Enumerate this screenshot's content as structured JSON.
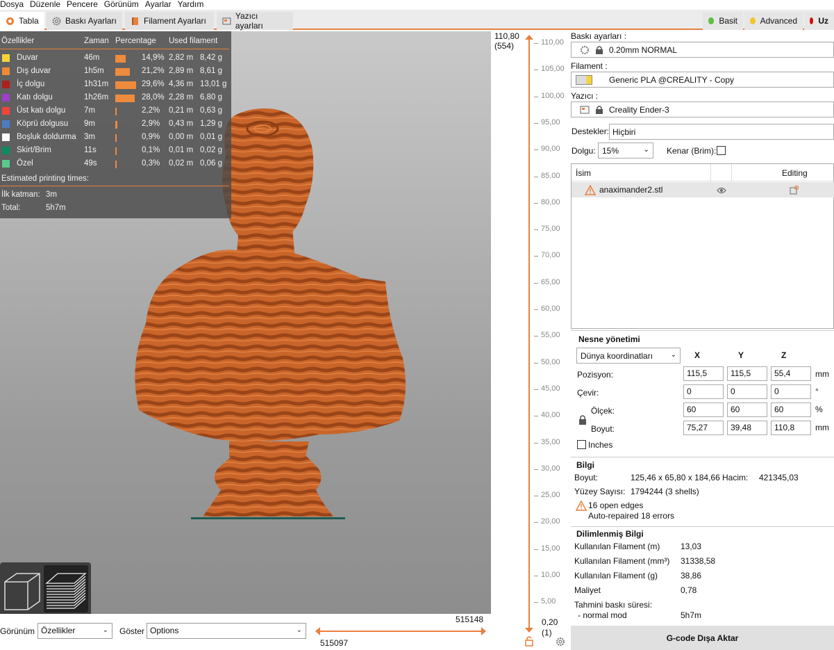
{
  "menu": [
    "Dosya",
    "Düzenle",
    "Pencere",
    "Görünüm",
    "Ayarlar",
    "Yardım"
  ],
  "tabs": [
    {
      "label": "Tabla",
      "icon": "plater-icon"
    },
    {
      "label": "Baskı Ayarları",
      "icon": "gear-icon"
    },
    {
      "label": "Filament Ayarları",
      "icon": "filament-spool-icon"
    },
    {
      "label": "Yazıcı ayarları",
      "icon": "printer-icon"
    }
  ],
  "modes": [
    {
      "label": "Basit",
      "color": "#5fbf3f"
    },
    {
      "label": "Advanced",
      "color": "#f2c52d"
    },
    {
      "label": "Uz",
      "color": "#d40d0d"
    }
  ],
  "legend": {
    "headers": [
      "Özellikler",
      "Zaman",
      "Percentage",
      "Used filament"
    ],
    "rows": [
      {
        "name": "Duvar",
        "color": "#f5d43a",
        "time": "46m",
        "pct": "14,9%",
        "pct_value": 14.9,
        "length": "2,82 m",
        "weight": "8,42 g"
      },
      {
        "name": "Dış duvar",
        "color": "#f08a36",
        "time": "1h5m",
        "pct": "21,2%",
        "pct_value": 21.2,
        "length": "2,89 m",
        "weight": "8,61 g"
      },
      {
        "name": "İç dolgu",
        "color": "#b0201a",
        "time": "1h31m",
        "pct": "29,6%",
        "pct_value": 29.6,
        "length": "4,36 m",
        "weight": "13,01 g"
      },
      {
        "name": "Katı dolgu",
        "color": "#9a41c8",
        "time": "1h26m",
        "pct": "28,0%",
        "pct_value": 28.0,
        "length": "2,28 m",
        "weight": "6,80 g"
      },
      {
        "name": "Üst katı dolgu",
        "color": "#f0443d",
        "time": "7m",
        "pct": "2,2%",
        "pct_value": 2.2,
        "length": "0,21 m",
        "weight": "0,63 g"
      },
      {
        "name": "Köprü dolgusu",
        "color": "#4d7bc4",
        "time": "9m",
        "pct": "2,9%",
        "pct_value": 2.9,
        "length": "0,43 m",
        "weight": "1,29 g"
      },
      {
        "name": "Boşluk doldurma",
        "color": "#ffffff",
        "time": "3m",
        "pct": "0,9%",
        "pct_value": 0.9,
        "length": "0,00 m",
        "weight": "0,01 g"
      },
      {
        "name": "Skirt/Brim",
        "color": "#0e8a63",
        "time": "11s",
        "pct": "0,1%",
        "pct_value": 0.1,
        "length": "0,01 m",
        "weight": "0,02 g"
      },
      {
        "name": "Özel",
        "color": "#5ac98c",
        "time": "49s",
        "pct": "0,3%",
        "pct_value": 0.3,
        "length": "0,02 m",
        "weight": "0,06 g"
      }
    ],
    "estimated_label": "Estimated printing times:",
    "first_layer_label": "İlk katman:",
    "first_layer_value": "3m",
    "total_label": "Total:",
    "total_value": "5h7m"
  },
  "bottom": {
    "view_label": "Görünüm",
    "view_value": "Özellikler",
    "show_label": "Göster",
    "show_value": "Options",
    "hslider_top": "515148",
    "hslider_bottom": "515097"
  },
  "vslider": {
    "top_value": "110,80",
    "top_layer": "(554)",
    "bottom_value": "0,20",
    "bottom_layer": "(1)",
    "ticks": [
      "110,00",
      "105,00",
      "100,00",
      "95,00",
      "90,00",
      "85,00",
      "80,00",
      "75,00",
      "70,00",
      "65,00",
      "60,00",
      "55,00",
      "50,00",
      "45,00",
      "40,00",
      "35,00",
      "30,00",
      "25,00",
      "20,00",
      "15,00",
      "10,00",
      "5,00"
    ]
  },
  "right": {
    "print_settings_label": "Baskı ayarları :",
    "print_settings_value": "0.20mm NORMAL",
    "filament_label": "Filament :",
    "filament_value": "Generic PLA @CREALITY - Copy",
    "printer_label": "Yazıcı :",
    "printer_value": "Creality Ender-3",
    "supports_label": "Destekler:",
    "supports_value": "Hiçbiri",
    "infill_label": "Dolgu:",
    "infill_value": "15%",
    "brim_label": "Kenar (Brim):",
    "objects_col_name": "İsim",
    "objects_col_editing": "Editing",
    "object_name": "anaximander2.stl",
    "object_mgmt_title": "Nesne yönetimi",
    "coord_select": "Dünya koordinatları",
    "axes": [
      "X",
      "Y",
      "Z"
    ],
    "position_label": "Pozisyon:",
    "position": [
      "115,5",
      "115,5",
      "55,4"
    ],
    "position_unit": "mm",
    "rotate_label": "Çevir:",
    "rotate": [
      "0",
      "0",
      "0"
    ],
    "rotate_unit": "°",
    "scale_label": "Ölçek:",
    "scale": [
      "60",
      "60",
      "60"
    ],
    "scale_unit": "%",
    "size_label": "Boyut:",
    "size": [
      "75,27",
      "39,48",
      "110,8"
    ],
    "size_unit": "mm",
    "inches_label": "Inches",
    "info_title": "Bilgi",
    "info_size_label": "Boyut:",
    "info_size_value": "125,46 x 65,80 x 184,66",
    "info_volume_label": "Hacim:",
    "info_volume_value": "421345,03",
    "info_facets_label": "Yüzey Sayısı:",
    "info_facets_value": "1794244 (3 shells)",
    "warning_line1": "16 open edges",
    "warning_line2": "Auto-repaired 18 errors",
    "sliced_title": "Dilimlenmiş Bilgi",
    "sliced": [
      {
        "label": "Kullanılan Filament (m)",
        "value": "13,03"
      },
      {
        "label": "Kullanılan Filament (mm³)",
        "value": "31338,58"
      },
      {
        "label": "Kullanılan Filament (g)",
        "value": "38,86"
      },
      {
        "label": "Maliyet",
        "value": "0,78"
      }
    ],
    "est_time_label": "Tahmini baskı süresi:",
    "normal_mode_label": "- normal mod",
    "normal_mode_value": "5h7m",
    "export_button": "G-code Dışa Aktar"
  }
}
